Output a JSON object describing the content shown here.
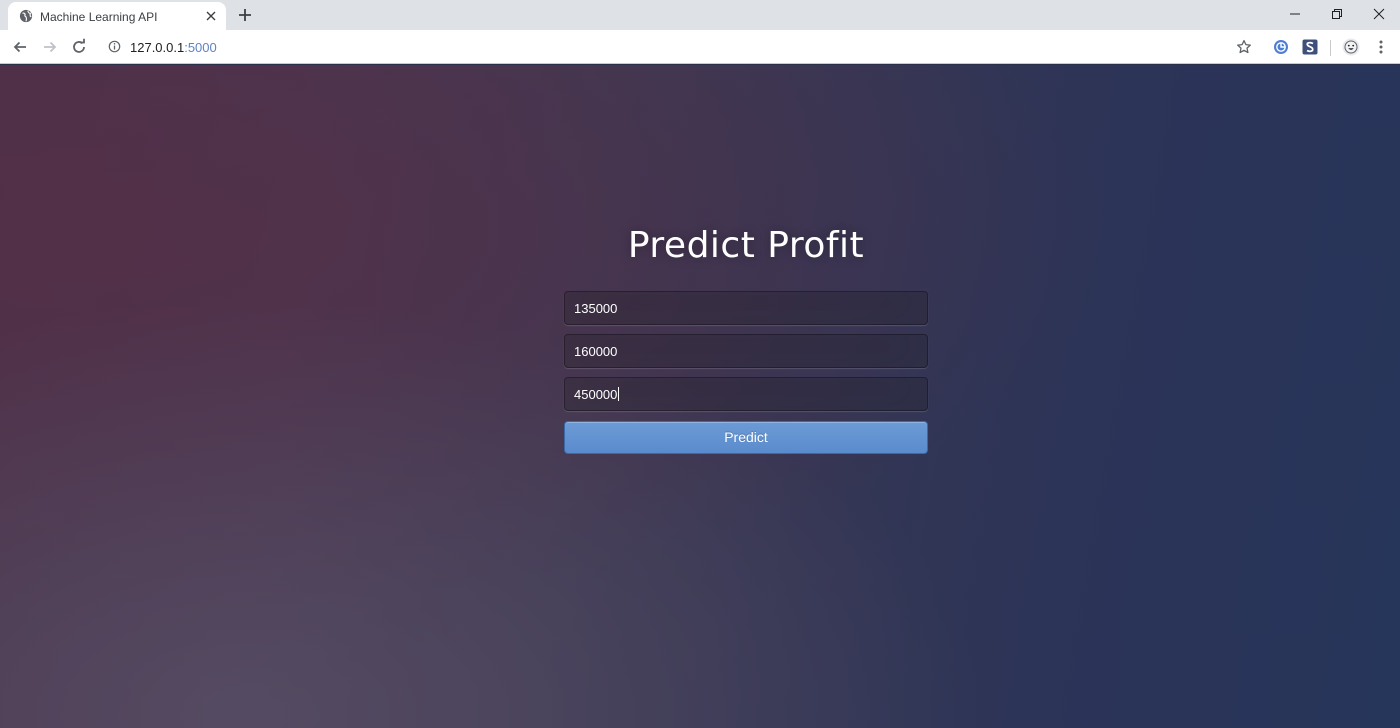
{
  "browser": {
    "tab_title": "Machine Learning API",
    "url_host": "127.0.0.1",
    "url_port": ":5000"
  },
  "page": {
    "title": "Predict Profit",
    "fields": [
      {
        "value": "135000"
      },
      {
        "value": "160000"
      },
      {
        "value": "450000"
      }
    ],
    "button_label": "Predict"
  },
  "colors": {
    "button": "#6495d2",
    "title": "#ffffff"
  }
}
